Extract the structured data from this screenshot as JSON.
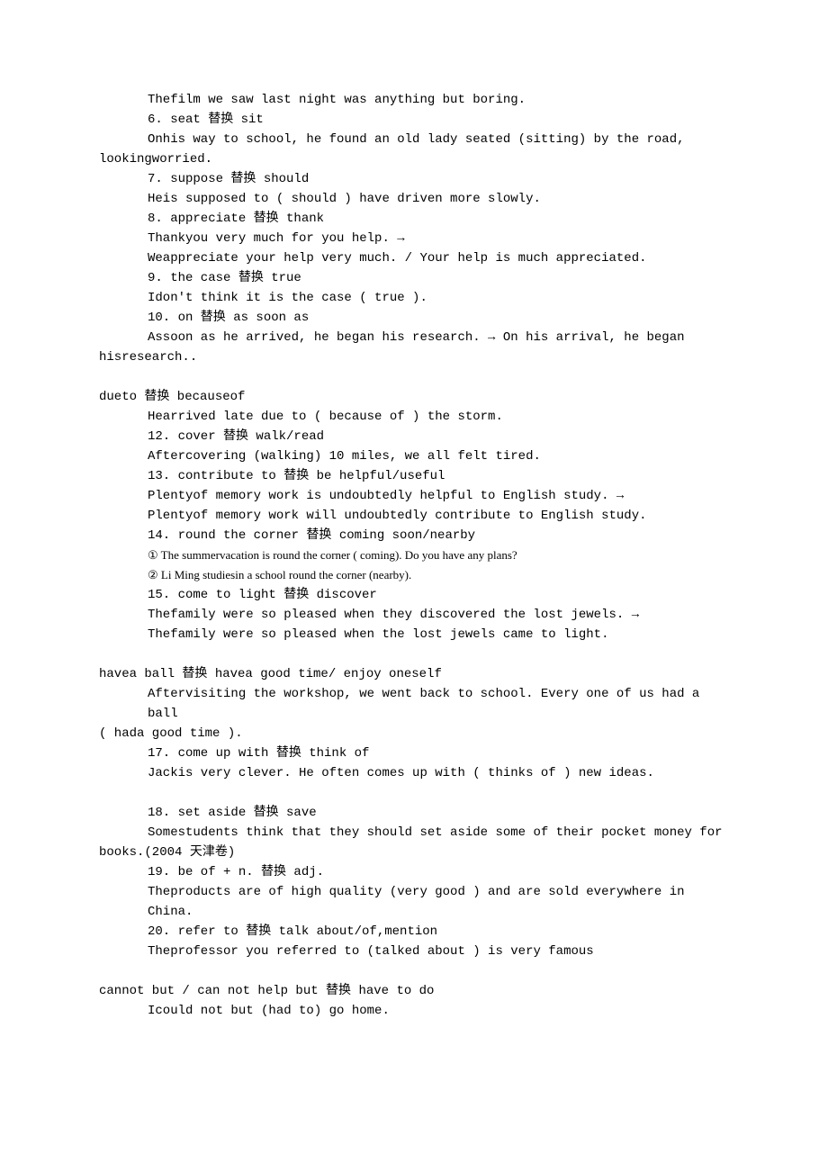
{
  "lines": [
    {
      "cls": "line indent",
      "t": "Thefilm we saw last night was anything but boring."
    },
    {
      "cls": "line indent",
      "t": "6. seat 替换 sit"
    },
    {
      "cls": "line indent",
      "t": "Onhis way to school, he found an old lady seated (sitting) by the road,"
    },
    {
      "cls": "line noindent",
      "t": "lookingworried."
    },
    {
      "cls": "line indent",
      "t": "7. suppose 替换 should"
    },
    {
      "cls": "line indent",
      "t": "Heis supposed to ( should ) have driven more slowly."
    },
    {
      "cls": "line indent",
      "t": "8. appreciate 替换 thank"
    },
    {
      "cls": "line indent",
      "t": "Thankyou very much for you help. →"
    },
    {
      "cls": "line indent",
      "t": "Weappreciate your help very much. / Your help is much appreciated."
    },
    {
      "cls": "line indent",
      "t": "9. the case 替换 true"
    },
    {
      "cls": "line indent",
      "t": "Idon't think it is the case ( true )."
    },
    {
      "cls": "line indent",
      "t": "10. on 替换 as soon as"
    },
    {
      "cls": "line indent",
      "t": "Assoon as he arrived, he began his research. → On his arrival, he began"
    },
    {
      "cls": "line noindent",
      "t": "hisresearch.."
    },
    {
      "cls": "spacer",
      "t": ""
    },
    {
      "cls": "line noindent",
      "t": "dueto 替换 becauseof"
    },
    {
      "cls": "line indent",
      "t": "Hearrived late due to ( because of ) the storm."
    },
    {
      "cls": "line indent",
      "t": "12. cover 替换 walk/read"
    },
    {
      "cls": "line indent",
      "t": "Aftercovering (walking) 10 miles, we all felt tired."
    },
    {
      "cls": "line indent",
      "t": "13. contribute to 替换 be helpful/useful"
    },
    {
      "cls": "line indent",
      "t": "Plentyof memory work is undoubtedly helpful to English study. →"
    },
    {
      "cls": "line indent",
      "t": "Plentyof memory work will undoubtedly contribute to English study."
    },
    {
      "cls": "line indent",
      "t": "14. round the corner 替换 coming soon/nearby"
    },
    {
      "cls": "line indent smallfont",
      "t": "① The summervacation is round the corner ( coming). Do you have any plans?"
    },
    {
      "cls": "line indent smallfont",
      "t": "② Li Ming studiesin a school round the corner (nearby)."
    },
    {
      "cls": "line indent",
      "t": "15. come to light 替换 discover"
    },
    {
      "cls": "line indent",
      "t": "Thefamily were so pleased when they discovered the lost jewels. →"
    },
    {
      "cls": "line indent",
      "t": "Thefamily were so pleased when the lost jewels came to light."
    },
    {
      "cls": "spacer",
      "t": ""
    },
    {
      "cls": "line noindent",
      "t": "havea ball 替换 havea good time/ enjoy oneself"
    },
    {
      "cls": "line indent",
      "t": "Aftervisiting the workshop, we went back to school. Every one of us had a ball"
    },
    {
      "cls": "line noindent",
      "t": "( hada good time )."
    },
    {
      "cls": "line indent",
      "t": "17. come up with 替换 think of"
    },
    {
      "cls": "line indent",
      "t": "Jackis very clever. He often comes up with ( thinks of ) new ideas."
    },
    {
      "cls": "spacer",
      "t": ""
    },
    {
      "cls": "line indent",
      "t": "18. set aside 替换 save"
    },
    {
      "cls": "line indent",
      "t": "Somestudents think that they should set aside some of their pocket money for"
    },
    {
      "cls": "line noindent",
      "t": "books.(2004 天津卷)"
    },
    {
      "cls": "line indent",
      "t": "19. be of + n. 替换 adj."
    },
    {
      "cls": "line indent",
      "t": "Theproducts are of high quality (very good ) and are sold everywhere in China."
    },
    {
      "cls": "line indent",
      "t": "20. refer to 替换 talk about/of,mention"
    },
    {
      "cls": "line indent",
      "t": "Theprofessor you referred to (talked about ) is very famous"
    },
    {
      "cls": "spacer",
      "t": ""
    },
    {
      "cls": "line noindent",
      "t": "cannot but / can not help but 替换 have to do"
    },
    {
      "cls": "line indent",
      "t": "Icould not but (had to) go home."
    }
  ]
}
